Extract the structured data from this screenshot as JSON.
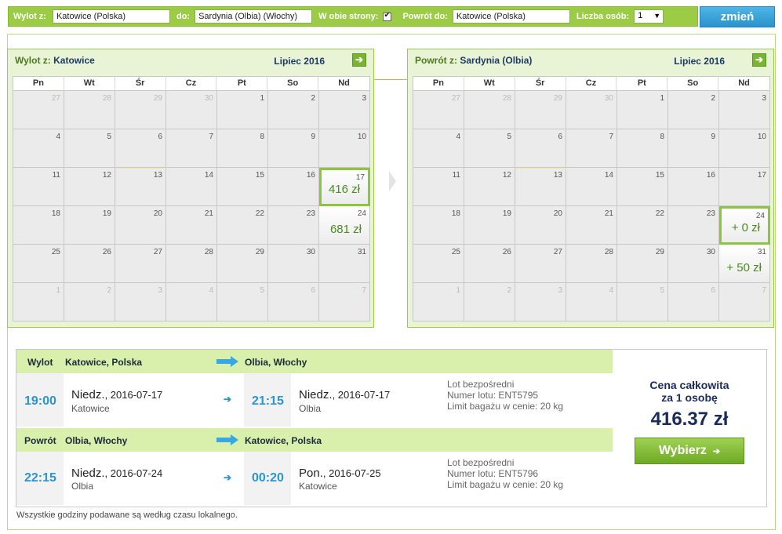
{
  "search": {
    "from_label": "Wylot z:",
    "from_value": "Katowice (Polska)",
    "to_label": "do:",
    "to_value": "Sardynia (Olbia) (Włochy)",
    "both_label": "W obie strony:",
    "return_label": "Powrót do:",
    "return_value": "Katowice (Polska)",
    "persons_label": "Liczba osób:",
    "persons_value": "1",
    "change_button": "zmień"
  },
  "calendars": {
    "weekdays": [
      "Pn",
      "Wt",
      "Śr",
      "Cz",
      "Pt",
      "So",
      "Nd"
    ],
    "outbound": {
      "route_prefix": "Wylot z:",
      "route_city": "Katowice",
      "month": "Lipiec 2016",
      "days": [
        {
          "d": "27",
          "out": true
        },
        {
          "d": "28",
          "out": true
        },
        {
          "d": "29",
          "out": true
        },
        {
          "d": "30",
          "out": true
        },
        {
          "d": "1"
        },
        {
          "d": "2"
        },
        {
          "d": "3"
        },
        {
          "d": "4"
        },
        {
          "d": "5"
        },
        {
          "d": "6"
        },
        {
          "d": "7"
        },
        {
          "d": "8"
        },
        {
          "d": "9"
        },
        {
          "d": "10"
        },
        {
          "d": "11"
        },
        {
          "d": "12"
        },
        {
          "d": "13",
          "today": true
        },
        {
          "d": "14"
        },
        {
          "d": "15"
        },
        {
          "d": "16"
        },
        {
          "d": "17",
          "price": "416 zł",
          "selected": true
        },
        {
          "d": "18"
        },
        {
          "d": "19"
        },
        {
          "d": "20"
        },
        {
          "d": "21"
        },
        {
          "d": "22"
        },
        {
          "d": "23"
        },
        {
          "d": "24",
          "price": "681 zł"
        },
        {
          "d": "25"
        },
        {
          "d": "26"
        },
        {
          "d": "27"
        },
        {
          "d": "28"
        },
        {
          "d": "29"
        },
        {
          "d": "30"
        },
        {
          "d": "31"
        },
        {
          "d": "1",
          "out": true
        },
        {
          "d": "2",
          "out": true
        },
        {
          "d": "3",
          "out": true
        },
        {
          "d": "4",
          "out": true
        },
        {
          "d": "5",
          "out": true
        },
        {
          "d": "6",
          "out": true
        },
        {
          "d": "7",
          "out": true
        }
      ]
    },
    "return": {
      "route_prefix": "Powrót z:",
      "route_city": "Sardynia (Olbia)",
      "month": "Lipiec 2016",
      "days": [
        {
          "d": "27",
          "out": true
        },
        {
          "d": "28",
          "out": true
        },
        {
          "d": "29",
          "out": true
        },
        {
          "d": "30",
          "out": true
        },
        {
          "d": "1"
        },
        {
          "d": "2"
        },
        {
          "d": "3"
        },
        {
          "d": "4"
        },
        {
          "d": "5"
        },
        {
          "d": "6"
        },
        {
          "d": "7"
        },
        {
          "d": "8"
        },
        {
          "d": "9"
        },
        {
          "d": "10"
        },
        {
          "d": "11"
        },
        {
          "d": "12"
        },
        {
          "d": "13",
          "today": true
        },
        {
          "d": "14"
        },
        {
          "d": "15"
        },
        {
          "d": "16"
        },
        {
          "d": "17"
        },
        {
          "d": "18"
        },
        {
          "d": "19"
        },
        {
          "d": "20"
        },
        {
          "d": "21"
        },
        {
          "d": "22"
        },
        {
          "d": "23"
        },
        {
          "d": "24",
          "price": "+ 0 zł",
          "selected": true
        },
        {
          "d": "25"
        },
        {
          "d": "26"
        },
        {
          "d": "27"
        },
        {
          "d": "28"
        },
        {
          "d": "29"
        },
        {
          "d": "30"
        },
        {
          "d": "31",
          "price": "+ 50 zł"
        },
        {
          "d": "1",
          "out": true
        },
        {
          "d": "2",
          "out": true
        },
        {
          "d": "3",
          "out": true
        },
        {
          "d": "4",
          "out": true
        },
        {
          "d": "5",
          "out": true
        },
        {
          "d": "6",
          "out": true
        },
        {
          "d": "7",
          "out": true
        }
      ]
    }
  },
  "summary": {
    "outbound": {
      "label": "Wylot",
      "from": "Katowice, Polska",
      "to": "Olbia, Włochy",
      "dep_time": "19:00",
      "dep_day": "Niedz.",
      "dep_date": ", 2016-07-17",
      "dep_city": "Katowice",
      "arr_time": "21:15",
      "arr_day": "Niedz.",
      "arr_date": ", 2016-07-17",
      "arr_city": "Olbia",
      "info1": "Lot bezpośredni",
      "info2": "Numer lotu: ENT5795",
      "info3": "Limit bagażu w cenie: 20 kg"
    },
    "return": {
      "label": "Powrót",
      "from": "Olbia, Włochy",
      "to": "Katowice, Polska",
      "dep_time": "22:15",
      "dep_day": "Niedz.",
      "dep_date": ", 2016-07-24",
      "dep_city": "Olbia",
      "arr_time": "00:20",
      "arr_day": "Pon.",
      "arr_date": ", 2016-07-25",
      "arr_city": "Katowice",
      "info1": "Lot bezpośredni",
      "info2": "Numer lotu: ENT5796",
      "info3": "Limit bagażu w cenie: 20 kg"
    },
    "total_label_1": "Cena całkowita",
    "total_label_2": "za 1 osobę",
    "total_value": "416.37 zł",
    "choose_button": "Wybierz"
  },
  "footnote": "Wszystkie godziny podawane są według czasu lokalnego.",
  "colors": {
    "brand_green": "#9ccc45",
    "price_blue": "#1b2b5a",
    "time_blue": "#2a96d0"
  }
}
